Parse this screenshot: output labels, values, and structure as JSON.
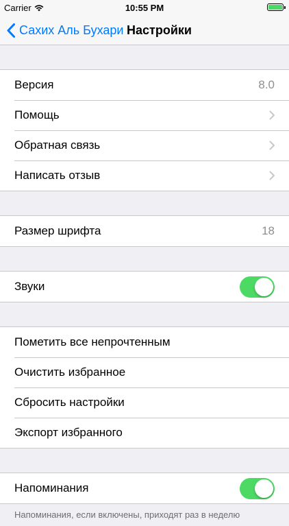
{
  "status_bar": {
    "carrier": "Carrier",
    "time": "10:55 PM",
    "battery_level": 1.0
  },
  "nav": {
    "back_label": "Сахих Аль Бухари",
    "title": "Настройки"
  },
  "group_info": {
    "version_label": "Версия",
    "version_value": "8.0",
    "help_label": "Помощь",
    "feedback_label": "Обратная связь",
    "review_label": "Написать отзыв"
  },
  "group_font": {
    "font_size_label": "Размер шрифта",
    "font_size_value": "18"
  },
  "group_sound": {
    "sounds_label": "Звуки",
    "sounds_on": true
  },
  "group_actions": {
    "mark_unread_label": "Пометить все непрочтенным",
    "clear_favorites_label": "Очистить избранное",
    "reset_settings_label": "Сбросить настройки",
    "export_favorites_label": "Экспорт избранного"
  },
  "group_reminders": {
    "reminders_label": "Напоминания",
    "reminders_on": true,
    "note": "Напоминания, если включены, приходят раз в неделю"
  },
  "colors": {
    "accent": "#007aff",
    "toggle_on": "#4cd964",
    "background": "#efeff4",
    "separator": "#c8c7cc",
    "secondary_text": "#8e8e93"
  },
  "icons": {
    "back": "chevron-left-icon",
    "disclosure": "chevron-right-icon",
    "wifi": "wifi-icon",
    "battery": "battery-icon"
  }
}
